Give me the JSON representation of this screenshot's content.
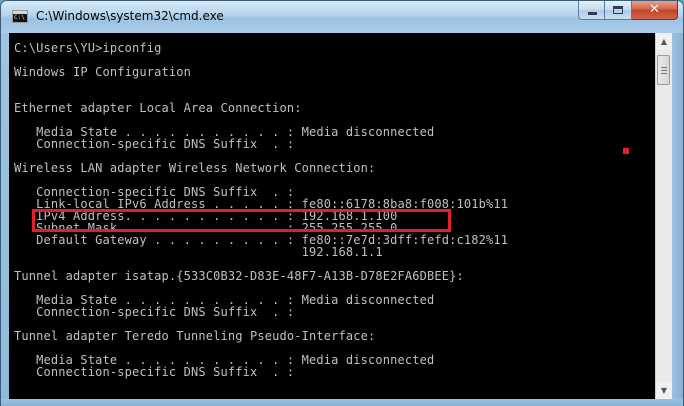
{
  "window": {
    "title": "C:\\Windows\\system32\\cmd.exe",
    "icon": "cmd-icon",
    "minimize_icon": "minimize-icon",
    "maximize_icon": "maximize-icon",
    "close_icon": "close-icon",
    "close_glyph": "✕"
  },
  "console": {
    "lines": [
      "C:\\Users\\YU>ipconfig",
      "",
      "Windows IP Configuration",
      "",
      "",
      "Ethernet adapter Local Area Connection:",
      "",
      "   Media State . . . . . . . . . . . : Media disconnected",
      "   Connection-specific DNS Suffix  . :",
      "",
      "Wireless LAN adapter Wireless Network Connection:",
      "",
      "   Connection-specific DNS Suffix  . :",
      "   Link-local IPv6 Address . . . . . : fe80::6178:8ba8:f008:101b%11",
      "   IPv4 Address. . . . . . . . . . . : 192.168.1.100",
      "   Subnet Mask . . . . . . . . . . . : 255.255.255.0",
      "   Default Gateway . . . . . . . . . : fe80::7e7d:3dff:fefd:c182%11",
      "                                       192.168.1.1",
      "",
      "Tunnel adapter isatap.{533C0B32-D83E-48F7-A13B-D78E2FA6DBEE}:",
      "",
      "   Media State . . . . . . . . . . . : Media disconnected",
      "   Connection-specific DNS Suffix  . :",
      "",
      "Tunnel adapter Teredo Tunneling Pseudo-Interface:",
      "",
      "   Media State . . . . . . . . . . . : Media disconnected",
      "   Connection-specific DNS Suffix  . :"
    ],
    "highlight_color": "#e2202a",
    "text_color": "#c0c0c0",
    "background_color": "#000000"
  },
  "scrollbar": {
    "up_icon": "scroll-up-arrow-icon",
    "down_icon": "scroll-down-arrow-icon",
    "up_glyph": "▲",
    "down_glyph": "▼"
  }
}
